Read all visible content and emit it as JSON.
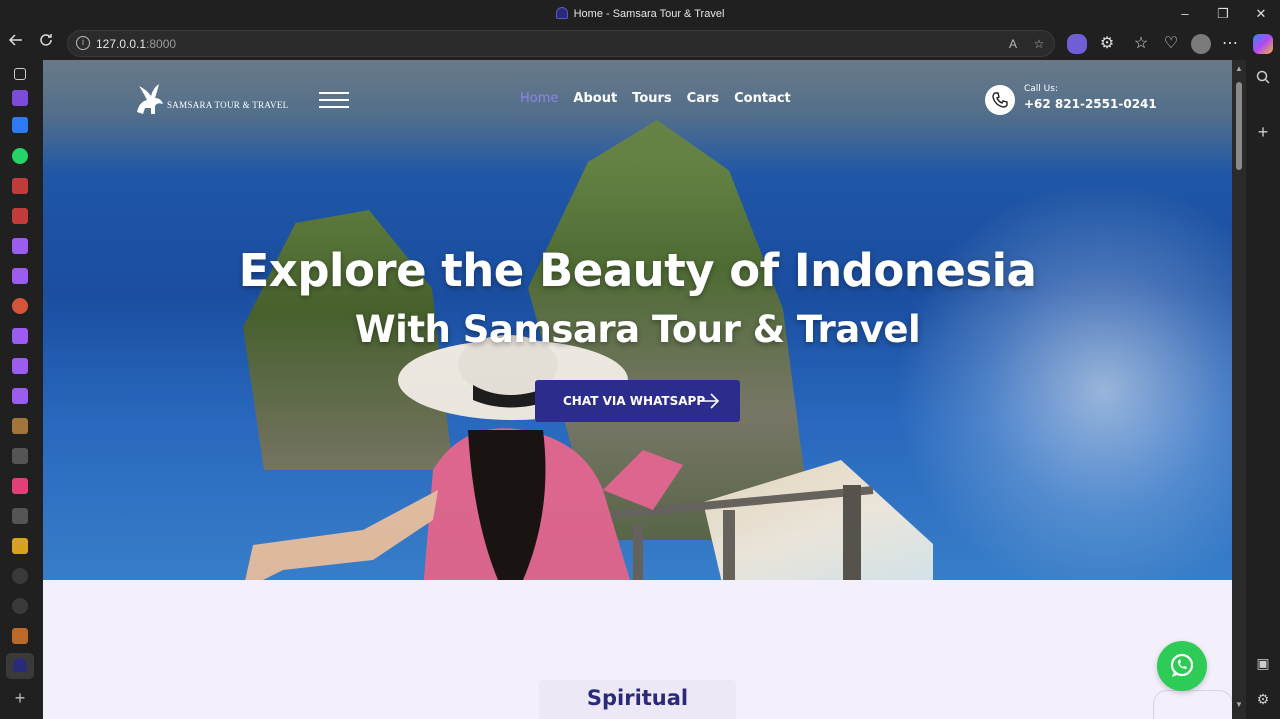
{
  "browser": {
    "tab_title": "Home - Samsara Tour & Travel",
    "url_host": "127.0.0.1",
    "url_port": ":8000",
    "minimize": "–",
    "restore": "❐",
    "close": "✕"
  },
  "site": {
    "logo_text": "SAMSARA TOUR & TRAVEL",
    "nav": [
      {
        "label": "Home",
        "active": true
      },
      {
        "label": "About"
      },
      {
        "label": "Tours"
      },
      {
        "label": "Cars"
      },
      {
        "label": "Contact"
      }
    ],
    "call_label": "Call Us:",
    "call_number": "+62 821-2551-0241",
    "hero_title": "Explore the Beauty of Indonesia",
    "hero_subtitle": "With Samsara Tour & Travel",
    "cta_label": "CHAT VIA WHATSAPP",
    "section_title": "Spiritual Journey"
  },
  "colors": {
    "accent": "#2b2c8c",
    "nav_active": "#8a84ee",
    "whatsapp": "#2ecc57",
    "page_bg": "#f3f0fc"
  }
}
